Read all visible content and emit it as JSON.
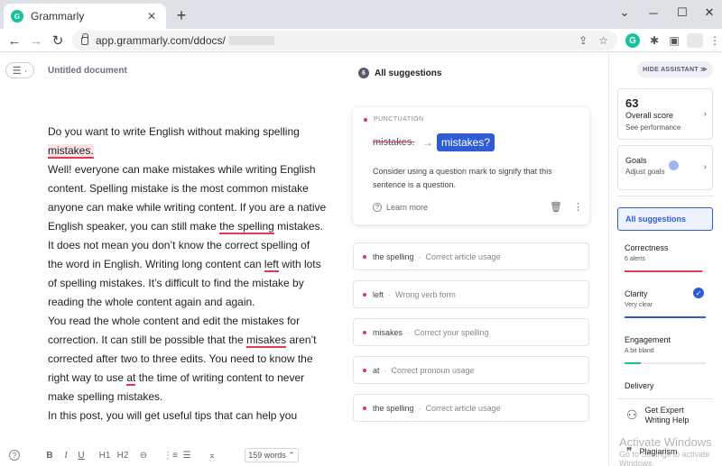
{
  "browser": {
    "tab_title": "Grammarly",
    "tab_close": "✕",
    "new_tab": "+",
    "url": "app.grammarly.com/ddocs/",
    "win_min": "─",
    "win_max": "☐",
    "win_close": "✕",
    "win_chevron": "⌄"
  },
  "editor": {
    "title": "Untitled document",
    "paragraphs": {
      "p1a": "Do you want to write English without making spelling ",
      "p1_err": "mistakes.",
      "p2": "Well! everyone can make mistakes while writing English content. Spelling mistake is the most common mistake anyone can make while writing content. If you are a native English speaker, you can still make ",
      "p2_err": "the spelling",
      "p2b": " mistakes.",
      "p3a": "It does not mean you don’t know the correct spelling of the word in English. Writing long content can ",
      "p3_err": "left",
      "p3b": " with lots of spelling mistakes. It’s difficult to find the mistake by reading the whole content again and again.",
      "p4a": "You read the whole content and edit the mistakes for correction. It can still be possible that the ",
      "p4_err1": "misakes",
      "p4b": " aren’t corrected after two to three edits. You need to know the right way to use ",
      "p4_err2": "at",
      "p4c": " the time of writing content to never make spelling mistakes.",
      "p5": "In this post, you will get useful tips that can help you"
    },
    "toolbar": {
      "help": "?",
      "bold": "B",
      "italic": "I",
      "underline": "U",
      "h1": "H1",
      "h2": "H2",
      "link": "⊖",
      "ol": "⋮≡",
      "ul": "☰",
      "clear": "⌅",
      "word_count": "159 words ⌃"
    }
  },
  "suggestions": {
    "count": "6",
    "header": "All suggestions",
    "main_card": {
      "category": "PUNCTUATION",
      "original": "mistakes.",
      "arrow": "→",
      "replacement": "mistakes?",
      "explanation": "Consider using a question mark to signify that this sentence is a question.",
      "learn_more": "Learn more",
      "trash": "🗑",
      "more": "⋮"
    },
    "items": [
      {
        "word": "the spelling",
        "desc": "Correct article usage"
      },
      {
        "word": "left",
        "desc": "Wrong verb form"
      },
      {
        "word": "misakes",
        "desc": "Correct your spelling"
      },
      {
        "word": "at",
        "desc": "Correct pronoun usage"
      },
      {
        "word": "the spelling",
        "desc": "Correct article usage"
      }
    ],
    "sep": "·"
  },
  "assistant": {
    "hide_label": "HIDE ASSISTANT ≫",
    "score": {
      "value": "63",
      "label": "Overall score",
      "sub": "See performance"
    },
    "goals": {
      "label": "Goals",
      "sub": "Adjust goals"
    },
    "chevron": "›",
    "all_suggestions": "All suggestions",
    "categories": {
      "correctness": {
        "label": "Correctness",
        "sub": "6 alerts",
        "level": 0.95
      },
      "clarity": {
        "label": "Clarity",
        "sub": "Very clear",
        "level": 1.0
      },
      "engagement": {
        "label": "Engagement",
        "sub": "A bit bland",
        "level": 0.2
      }
    },
    "delivery": "Delivery",
    "expert": "Get Expert Writing Help",
    "plagiarism": "Plagiarism"
  },
  "watermark": {
    "line1": "Activate Windows",
    "line2": "Go to Settings to activate Windows."
  },
  "colors": {
    "accent": "#2f5cd6",
    "error": "#e03a57",
    "success": "#15c39a"
  }
}
